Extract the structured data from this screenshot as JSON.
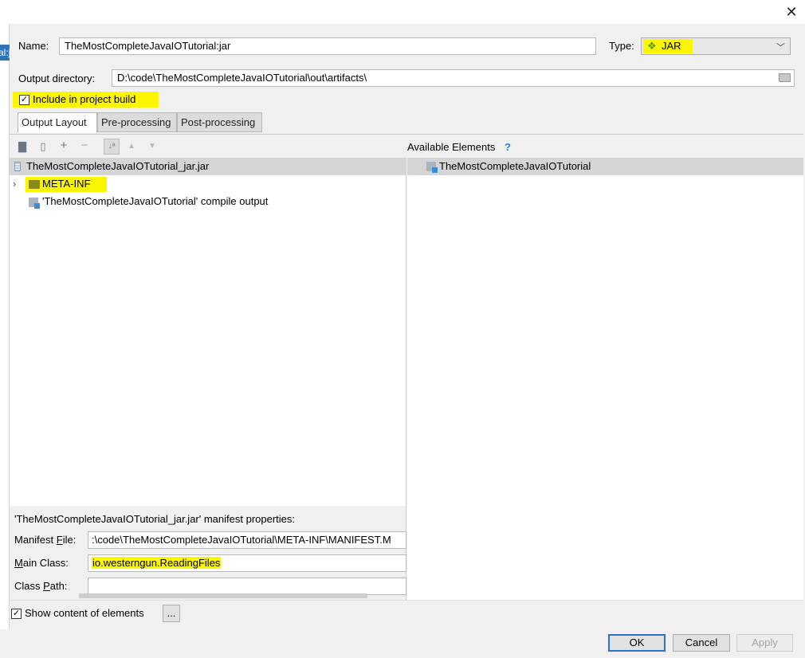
{
  "window": {
    "close_glyph": "✕"
  },
  "side_tab": {
    "label": "al:ja"
  },
  "form": {
    "name_label": "Name:",
    "name_value": "TheMostCompleteJavaIOTutorial:jar",
    "type_label": "Type:",
    "type_value": "JAR",
    "type_icon": "jar-type-icon",
    "output_dir_label": "Output directory:",
    "output_dir_value": "D:\\code\\TheMostCompleteJavaIOTutorial\\out\\artifacts\\",
    "include_label": "Include in project build",
    "include_checked": true
  },
  "tabs": [
    {
      "label": "Output Layout",
      "active": true
    },
    {
      "label": "Pre-processing",
      "active": false
    },
    {
      "label": "Post-processing",
      "active": false
    }
  ],
  "toolbar": {
    "icons": [
      "new-folder-icon",
      "archive-icon",
      "add-icon",
      "remove-icon",
      "sort-icon",
      "move-up-icon",
      "move-down-icon"
    ]
  },
  "tree": {
    "root": "TheMostCompleteJavaIOTutorial_jar.jar",
    "items": [
      {
        "label": "META-INF",
        "icon": "folder-icon",
        "expandable": true
      },
      {
        "label": "'TheMostCompleteJavaIOTutorial' compile output",
        "icon": "module-icon",
        "expandable": false
      }
    ]
  },
  "available": {
    "header": "Available Elements",
    "help": "?",
    "items": [
      {
        "label": "TheMostCompleteJavaIOTutorial",
        "icon": "module-icon"
      }
    ]
  },
  "manifest": {
    "title": "'TheMostCompleteJavaIOTutorial_jar.jar' manifest properties:",
    "file_label": "Manifest File:",
    "file_value": ":\\code\\TheMostCompleteJavaIOTutorial\\META-INF\\MANIFEST.M",
    "main_class_label": "Main Class:",
    "main_class_value": "io.westerngun.ReadingFiles",
    "class_path_label": "Class Path:",
    "class_path_value": ""
  },
  "bottom": {
    "show_content_label": "Show content of elements",
    "show_content_checked": true,
    "ellipsis_label": "..."
  },
  "buttons": {
    "ok": "OK",
    "cancel": "Cancel",
    "apply": "Apply"
  },
  "colors": {
    "highlight": "#fbf600",
    "accent": "#2c73c8",
    "side_tab": "#2f73b8"
  }
}
